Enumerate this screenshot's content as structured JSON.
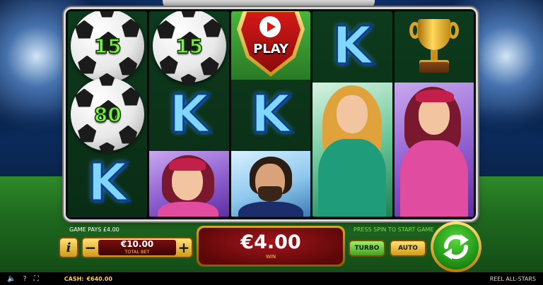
{
  "reels": {
    "ball_values": [
      "15",
      "15",
      "80"
    ],
    "k_symbol": "K",
    "play_label": "PLAY"
  },
  "controls": {
    "game_pays": "GAME PAYS £4.00",
    "hint": "PRESS SPIN TO START GAME",
    "info_label": "i",
    "minus_label": "−",
    "plus_label": "+",
    "bet_value": "€10.00",
    "bet_label": "TOTAL BET",
    "win_value": "€4.00",
    "win_label": "WIN",
    "turbo_label": "TURBO",
    "auto_label": "AUTO"
  },
  "status": {
    "cash_label": "CASH:",
    "cash_value": "€640.00",
    "game_name": "REEL ALL-STARS",
    "help_label": "?"
  },
  "colors": {
    "ball_value": "#7ef04a",
    "k_symbol": "#7fd6ff",
    "win_panel": "#a2151a",
    "spin_button": "#1b8c13",
    "accent_gold": "#ffd24a"
  }
}
